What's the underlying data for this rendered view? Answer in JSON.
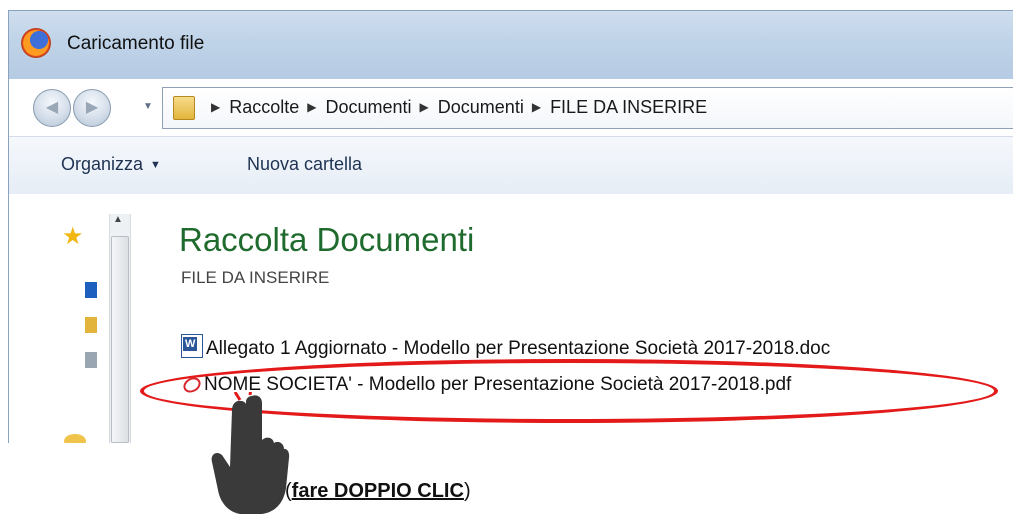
{
  "window": {
    "title": "Caricamento file",
    "icon": "firefox-icon"
  },
  "address_bar": {
    "breadcrumbs": [
      "Raccolte",
      "Documenti",
      "Documenti",
      "FILE DA INSERIRE"
    ]
  },
  "toolbar": {
    "organize_label": "Organizza",
    "new_folder_label": "Nuova cartella"
  },
  "library": {
    "title": "Raccolta Documenti",
    "subtitle": "FILE DA INSERIRE"
  },
  "files": [
    {
      "name": "Allegato 1 Aggiornato - Modello per Presentazione Società 2017-2018.doc",
      "icon": "word-doc-icon"
    },
    {
      "name": "NOME SOCIETA' - Modello per Presentazione Società 2017-2018.pdf",
      "icon": "pdf-icon"
    }
  ],
  "annotation": {
    "open_paren": "(",
    "instruction": "fare DOPPIO CLIC",
    "close_paren": ")",
    "highlight_color": "#e41a1a"
  }
}
